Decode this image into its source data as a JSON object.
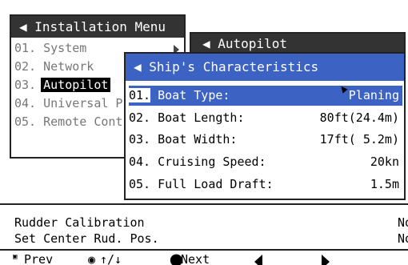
{
  "installation_menu": {
    "title": "◀ Installation Menu",
    "items": [
      {
        "num": "01.",
        "label": "System"
      },
      {
        "num": "02.",
        "label": "Network"
      },
      {
        "num": "03.",
        "label": "Autopilot"
      },
      {
        "num": "04.",
        "label": "Universal P"
      },
      {
        "num": "05.",
        "label": "Remote Cont"
      }
    ]
  },
  "autopilot_menu": {
    "title": "◀ Autopilot"
  },
  "ships_characteristics": {
    "title": "◀ Ship's Characteristics",
    "rows": [
      {
        "num": "01.",
        "label": "Boat Type:",
        "value": "Planing"
      },
      {
        "num": "02.",
        "label": "Boat Length:",
        "value": "80ft(24.4m)"
      },
      {
        "num": "03.",
        "label": "Boat Width:",
        "value": "17ft( 5.2m)"
      },
      {
        "num": "04.",
        "label": "Cruising Speed:",
        "value": "20kn"
      },
      {
        "num": "05.",
        "label": "Full Load Draft:",
        "value": "1.5m"
      }
    ]
  },
  "status": {
    "rudder_calibration": {
      "label": "Rudder Calibration",
      "value": "No"
    },
    "set_center_rudder": {
      "label": "Set Center Rud. Pos.",
      "value": "No"
    }
  },
  "footer": {
    "prev_label": "Prev",
    "nav_label": "↑/↓",
    "next_label": "Next"
  }
}
